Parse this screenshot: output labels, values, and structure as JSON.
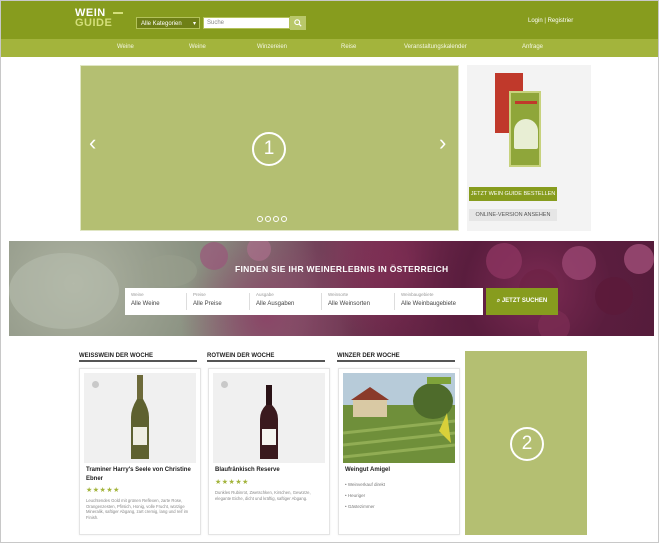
{
  "colors": {
    "topbar": "#879c1e",
    "navbar": "#a3b43c",
    "accent": "#879c1e",
    "placeholder": "#b4bf72"
  },
  "header": {
    "logo_line1": "WEIN",
    "logo_line2": "GUIDE",
    "category_select": "Alle Kategorien",
    "search_placeholder": "Suche",
    "search_icon": "search-icon",
    "login": "Login | Registrier"
  },
  "nav": {
    "items": [
      "Weine",
      "Weine",
      "Winzereien",
      "Reise",
      "Veranstaltungskalender",
      "Anfrage"
    ]
  },
  "hero": {
    "slide_number": "1",
    "prev_icon": "chevron-left-icon",
    "next_icon": "chevron-right-icon",
    "dots": 4,
    "active_dot": 0
  },
  "ad": {
    "button_primary": "JETZT WEIN GUIDE BESTELLEN",
    "button_secondary": "ONLINE-VERSION ANSEHEN"
  },
  "finder": {
    "title": "FINDEN SIE IHR WEINERLEBNIS IN ÖSTERREICH",
    "filters": [
      {
        "label": "Weine",
        "value": "Alle Weine"
      },
      {
        "label": "Preise",
        "value": "Alle Preise"
      },
      {
        "label": "Ausgabe",
        "value": "Alle Ausgaben"
      },
      {
        "label": "Weinsorte",
        "value": "Alle Weinsorten"
      },
      {
        "label": "Weinbaugebiete",
        "value": "Alle Weinbaugebiete"
      }
    ],
    "button": "JETZT SUCHEN"
  },
  "sections": [
    {
      "title": "WEISSWEIN DER WOCHE",
      "name": "Traminer Harry's Seele von Christine Ebner",
      "stars": "★★★★★",
      "description": "Leuchtendes Gold mit grünen Reflexen, zarte Rose, Orangenzesten, Pfirsich, Honig, volle Frucht, würzige Mineralik, saftiger Abgang, zart cremig, lang und reif im Finish."
    },
    {
      "title": "ROTWEIN DER WOCHE",
      "name": "Blaufränkisch Reserve",
      "stars": "★★★★★",
      "description": "Dunkles Rubinrot, Zwetschken, Kirschen, Gewürze, elegante Eiche, dicht und kräftig, saftiger Abgang."
    },
    {
      "title": "WINZER DER WOCHE",
      "name": "Weingut Amigel",
      "list": [
        "Weinverkauf direkt",
        "Heuriger",
        "Gästezimmer"
      ]
    }
  ],
  "side_ad": {
    "number": "2"
  }
}
